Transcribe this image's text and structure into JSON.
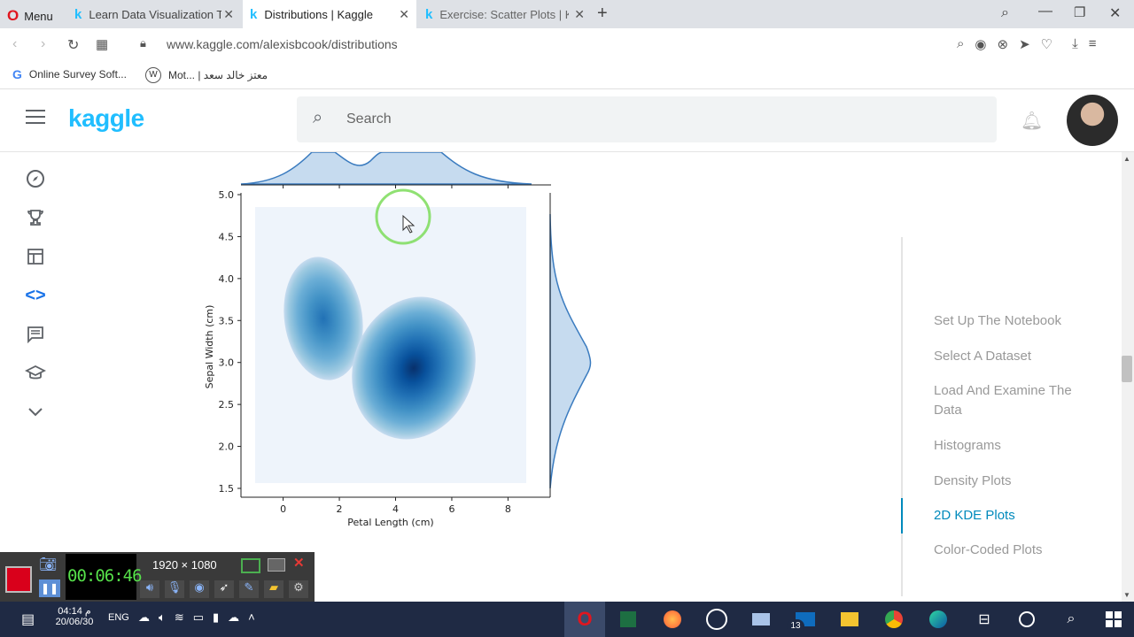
{
  "browser": {
    "menu_label": "Menu",
    "tabs": [
      {
        "title": "Learn Data Visualization Tu",
        "active": false
      },
      {
        "title": "Distributions | Kaggle",
        "active": true
      },
      {
        "title": "Exercise: Scatter Plots | Kag",
        "active": false
      }
    ],
    "url": "www.kaggle.com/alexisbcook/distributions",
    "bookmarks": [
      "Online Survey Soft...",
      "Mot... | معتز خالد سعد"
    ]
  },
  "kaggle": {
    "logo": "kaggle",
    "search_placeholder": "Search",
    "sidebar_icons": [
      "compass-icon",
      "trophy-icon",
      "table-icon",
      "code-icon",
      "comment-icon",
      "school-icon",
      "chevron-down-icon"
    ]
  },
  "toc": {
    "items": [
      {
        "label": "Set Up The Notebook",
        "active": false
      },
      {
        "label": "Select A Dataset",
        "active": false
      },
      {
        "label": "Load And Examine The Data",
        "active": false
      },
      {
        "label": "Histograms",
        "active": false
      },
      {
        "label": "Density Plots",
        "active": false
      },
      {
        "label": "2D KDE Plots",
        "active": true
      },
      {
        "label": "Color-Coded Plots",
        "active": false
      }
    ]
  },
  "chart_data": {
    "type": "heatmap",
    "subtype": "kde-jointplot",
    "xlabel": "Petal Length (cm)",
    "ylabel": "Sepal Width (cm)",
    "xticks": [
      "0",
      "2",
      "4",
      "6",
      "8"
    ],
    "yticks": [
      "1.5",
      "2.0",
      "2.5",
      "3.0",
      "3.5",
      "4.0",
      "4.5",
      "5.0"
    ],
    "xlim": [
      -1.5,
      9.5
    ],
    "ylim": [
      1.5,
      5.0
    ],
    "peaks": [
      {
        "x": 1.5,
        "y": 3.4,
        "relative_density": 0.55
      },
      {
        "x": 4.8,
        "y": 2.95,
        "relative_density": 1.0
      }
    ],
    "colormap": "Blues"
  },
  "recorder": {
    "resolution": "1920 × 1080",
    "elapsed": "00:06:46"
  },
  "taskbar": {
    "time": "04:14 م",
    "date": "20/06/30",
    "language": "ENG",
    "mail_badge": "13"
  }
}
